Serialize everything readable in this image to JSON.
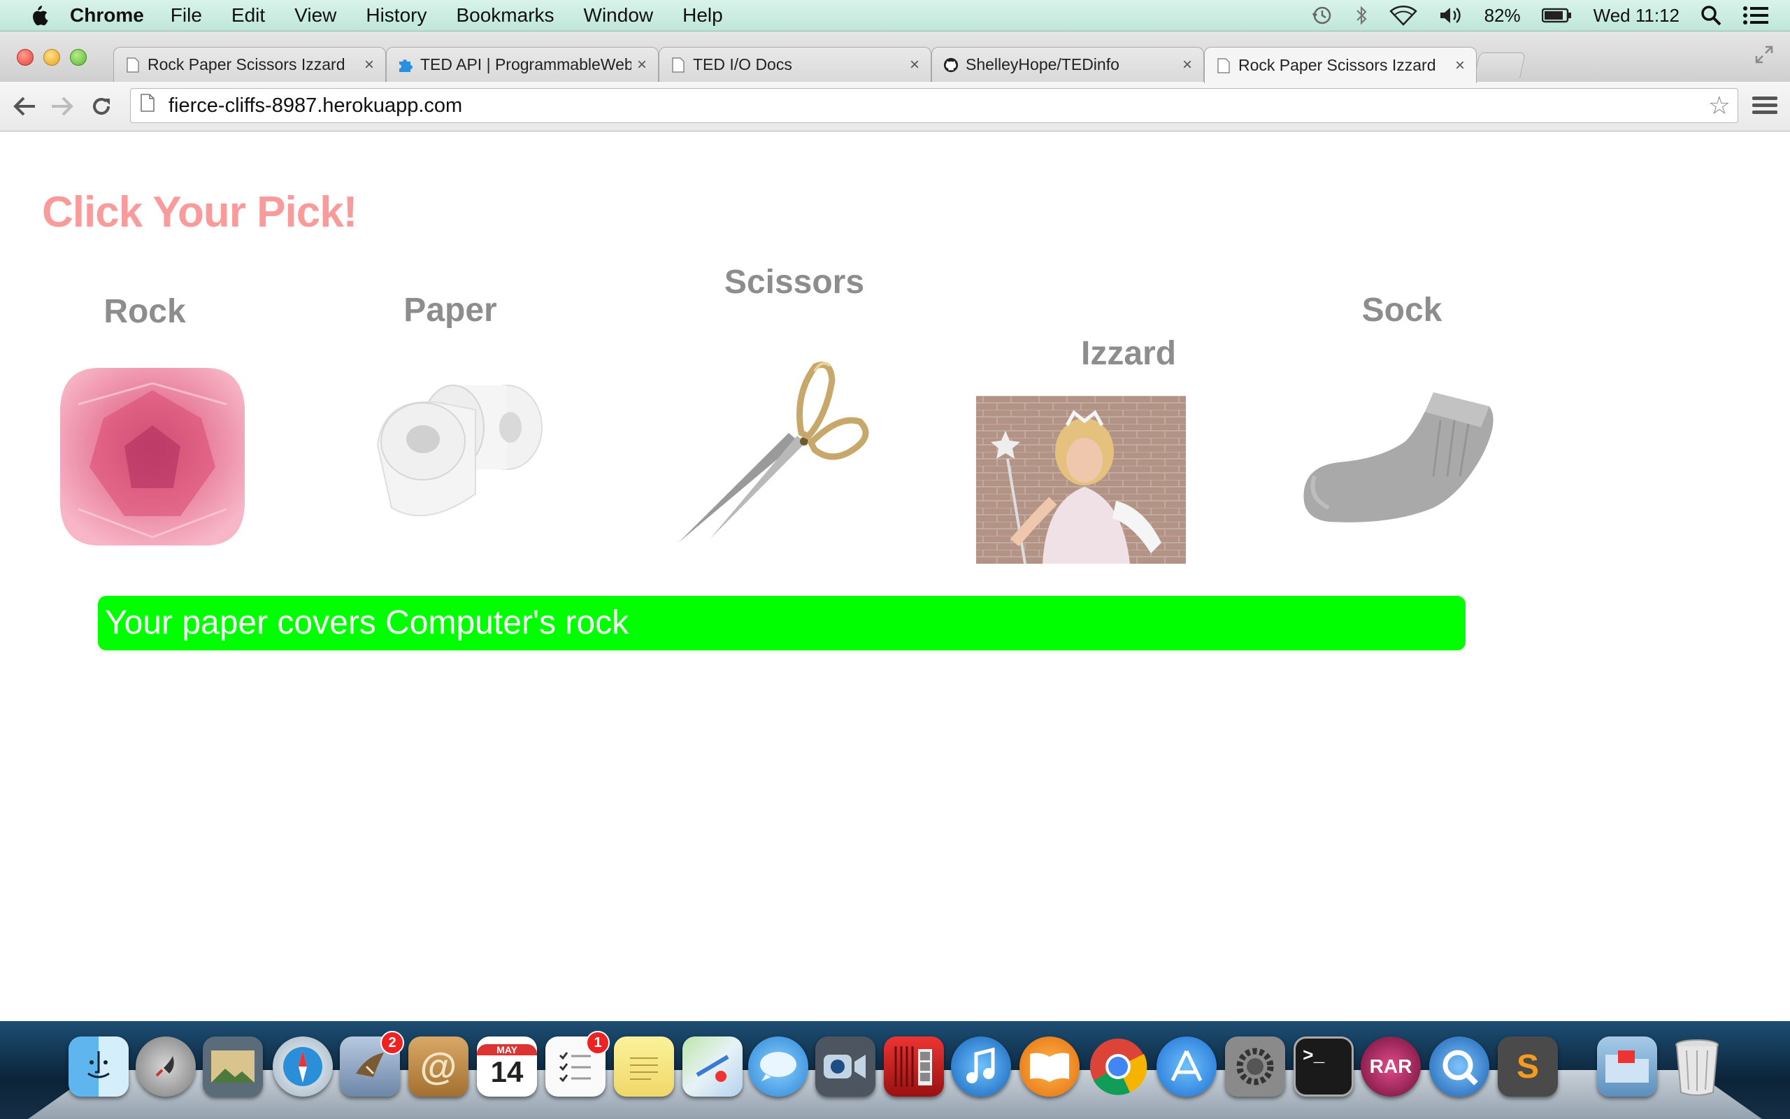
{
  "menubar": {
    "app": "Chrome",
    "items": [
      "File",
      "Edit",
      "View",
      "History",
      "Bookmarks",
      "Window",
      "Help"
    ],
    "battery": "82%",
    "clock": "Wed 11:12"
  },
  "tabs": [
    {
      "title": "Rock Paper Scissors Izzard",
      "icon": "page-icon",
      "active": false
    },
    {
      "title": "TED API | ProgrammableWeb",
      "icon": "puzzle-icon",
      "active": false
    },
    {
      "title": "TED I/O Docs",
      "icon": "page-icon",
      "active": false
    },
    {
      "title": "ShelleyHope/TEDinfo",
      "icon": "github-icon",
      "active": false
    },
    {
      "title": "Rock Paper Scissors Izzard",
      "icon": "page-icon",
      "active": true
    }
  ],
  "tab_close": "×",
  "address": {
    "url": "fierce-cliffs-8987.herokuapp.com"
  },
  "page": {
    "heading": "Click Your Pick!",
    "choices": {
      "rock": "Rock",
      "paper": "Paper",
      "scissors": "Scissors",
      "izzard": "Izzard",
      "sock": "Sock"
    },
    "result": "Your paper covers Computer's rock"
  },
  "dock": {
    "calendar_month": "MAY",
    "calendar_day": "14",
    "mail_badge": "2",
    "reminders_badge": "1",
    "rar_label": "RAR",
    "sublime_label": "S",
    "terminal_label": ">_",
    "icons": [
      "finder-icon",
      "launchpad-icon",
      "photos-icon",
      "safari-icon",
      "mail-icon",
      "contacts-icon",
      "calendar-icon",
      "reminders-icon",
      "notes-icon",
      "maps-icon",
      "messages-icon",
      "facetime-icon",
      "photo-booth-icon",
      "itunes-icon",
      "ibooks-icon",
      "chrome-icon",
      "app-store-icon",
      "system-preferences-icon",
      "terminal-icon",
      "rar-icon",
      "quicktime-icon",
      "sublime-text-icon",
      "downloads-folder-icon",
      "trash-icon"
    ]
  },
  "colors": {
    "heading": "#fa9b9b",
    "choice_label": "#8d8d8d",
    "result_bg": "#00ff00",
    "result_text": "#ffffff"
  }
}
